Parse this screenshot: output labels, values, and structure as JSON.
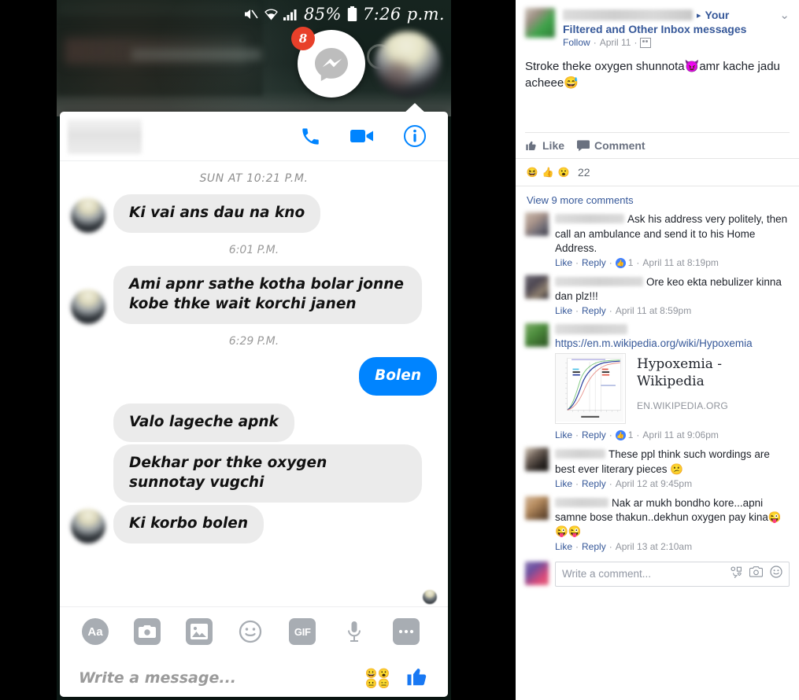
{
  "phone": {
    "statusbar": {
      "mute_icon": "mute-icon",
      "wifi_icon": "wifi-icon",
      "signal_icon": "signal-icon",
      "battery_percent": "85%",
      "battery_icon": "battery-icon",
      "time": "7:26 p.m."
    },
    "chat_heads": {
      "messenger_badge": "8",
      "messenger_icon": "messenger-icon",
      "friend_avatar": "friend-avatar"
    },
    "chat_card": {
      "header": {
        "contact_name_redacted": "",
        "call_icon": "phone-call-icon",
        "video_icon": "video-call-icon",
        "info_icon": "info-icon"
      },
      "separators": {
        "day": "SUN AT 10:21 P.M.",
        "t1": "6:01 P.M.",
        "t2": "6:29 P.M."
      },
      "messages": [
        {
          "side": "in",
          "text": "Ki vai ans dau na kno"
        },
        {
          "side": "in",
          "text": "Ami apnr sathe kotha bolar jonne kobe thke wait korchi janen"
        },
        {
          "side": "out",
          "text": "Bolen"
        },
        {
          "side": "in",
          "text": "Valo lageche apnk"
        },
        {
          "side": "in",
          "text": "Dekhar por thke oxygen sunnotay vugchi"
        },
        {
          "side": "in",
          "text": "Ki korbo bolen"
        }
      ],
      "react_button": "☺",
      "react_plus": "+"
    },
    "composer": {
      "tools": [
        {
          "name": "text-format-button",
          "label": "Aa"
        },
        {
          "name": "camera-button",
          "label": ""
        },
        {
          "name": "gallery-button",
          "label": ""
        },
        {
          "name": "sticker-button",
          "label": ""
        },
        {
          "name": "gif-button",
          "label": "GIF"
        },
        {
          "name": "voice-record-button",
          "label": ""
        },
        {
          "name": "more-options-button",
          "label": ""
        }
      ],
      "input_placeholder": "Write a message...",
      "emoji_picker_icon": "emoji-grid-icon",
      "like_icon": "thumbs-up-icon"
    }
  },
  "facebook": {
    "post": {
      "author_redacted": "",
      "share_arrow": "▸",
      "share_target_word": "Your",
      "group_name": "Filtered and Other Inbox messages",
      "follow_label": "Follow",
      "date": "April 11",
      "privacy_icon": "group-privacy-icon",
      "menu_icon": "chevron-down-icon",
      "text_part1": "Stroke theke oxygen shunnota",
      "emoji1": "😈",
      "text_part2": "amr kache jadu acheee",
      "emoji2": "😅"
    },
    "actions": {
      "like_label": "Like",
      "like_icon": "thumbs-up-icon",
      "comment_label": "Comment",
      "comment_icon": "comment-bubble-icon"
    },
    "reactions": {
      "icons": [
        "😆",
        "👍",
        "😮"
      ],
      "count": "22"
    },
    "view_more_comments": "View 9 more comments",
    "comments": [
      {
        "name_redacted": "",
        "name_blur_width": 88,
        "text": "Ask his address very politely, then call an ambulance and send it to his Home Address.",
        "like": "Like",
        "reply": "Reply",
        "like_count": "1",
        "timestamp": "April 11 at 8:19pm",
        "avatar_colors": [
          "#cdbdb0",
          "#a9948a",
          "#6d6a74",
          "#3a3a46"
        ]
      },
      {
        "name_redacted": "",
        "name_blur_width": 112,
        "text": "Ore keo ekta nebulizer kinna dan plz!!!",
        "like": "Like",
        "reply": "Reply",
        "like_count": "",
        "timestamp": "April 11 at 8:59pm",
        "avatar_colors": [
          "#6f6a74",
          "#4d4752",
          "#8e7f6e",
          "#2c2a33"
        ]
      },
      {
        "name_redacted": "",
        "name_blur_width": 92,
        "url": "https://en.m.wikipedia.org/wiki/Hypoxemia",
        "link_title": "Hypoxemia - Wikipedia",
        "link_domain": "EN.WIKIPEDIA.ORG",
        "like": "Like",
        "reply": "Reply",
        "like_count": "1",
        "timestamp": "April 11 at 9:06pm",
        "avatar_colors": [
          "#7fae6a",
          "#4f8f3f",
          "#3a6b2d",
          "#2f5a26"
        ]
      },
      {
        "name_redacted": "",
        "name_blur_width": 64,
        "text": "These ppl think such wordings are best ever literary pieces 😕",
        "like": "Like",
        "reply": "Reply",
        "like_count": "",
        "timestamp": "April 12 at 9:45pm",
        "avatar_colors": [
          "#d9cdbd",
          "#6e6158",
          "#2b2623",
          "#15120f"
        ]
      },
      {
        "name_redacted": "",
        "name_blur_width": 68,
        "text": "Nak ar mukh bondho kore...apni samne bose thakun..dekhun oxygen pay kina😜 😜😜",
        "like": "Like",
        "reply": "Reply",
        "like_count": "",
        "timestamp": "April 13 at 2:10am",
        "avatar_colors": [
          "#d3b79a",
          "#b98f62",
          "#7c5b3c",
          "#4a3524"
        ]
      }
    ],
    "compose": {
      "avatar_colors": [
        "#8e7bb5",
        "#6b4fa0",
        "#d94a7a",
        "#e8657f"
      ],
      "placeholder": "Write a comment...",
      "sticker_icon": "sticker-icon",
      "camera_icon": "camera-icon",
      "emoji_icon": "emoji-icon"
    }
  },
  "colors": {
    "fb_blue": "#365899",
    "messenger_blue": "#0084ff",
    "bubble_gray": "#ebebeb",
    "badge_red": "#e8402a"
  }
}
